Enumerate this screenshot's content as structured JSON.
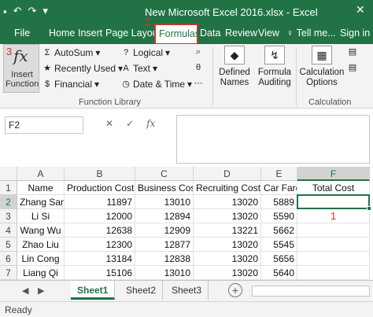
{
  "window": {
    "title": "New Microsoft Excel 2016.xlsx - Excel",
    "save_icon": "save-icon",
    "undo_icon": "undo-icon",
    "redo_icon": "redo-icon"
  },
  "tabs": [
    {
      "label": "File"
    },
    {
      "label": "Home"
    },
    {
      "label": "Insert"
    },
    {
      "label": "Page Layout"
    },
    {
      "label": "Formulas",
      "active": true
    },
    {
      "label": "Data"
    },
    {
      "label": "Review"
    },
    {
      "label": "View"
    }
  ],
  "tell_me": "Tell me...",
  "sign_in": "Sign in",
  "markers": {
    "m1": "1",
    "m2": "2",
    "m3": "3"
  },
  "ribbon": {
    "insert_function": {
      "icon": "fx",
      "label": "Insert Function"
    },
    "library": [
      {
        "label": "AutoSum",
        "icon": "Σ"
      },
      {
        "label": "Recently Used",
        "icon": "★"
      },
      {
        "label": "Financial",
        "icon": "$"
      },
      {
        "label": "Logical",
        "icon": "?"
      },
      {
        "label": "Text",
        "icon": "A"
      },
      {
        "label": "Date & Time",
        "icon": "◷"
      }
    ],
    "defined_names": "Defined Names",
    "formula_auditing": "Formula Auditing",
    "calc_options": "Calculation Options",
    "group_function_library": "Function Library",
    "group_calculation": "Calculation"
  },
  "formula_bar": {
    "name_box": "F2",
    "cancel": "✕",
    "enter": "✓",
    "fx": "fx",
    "value": ""
  },
  "columns": [
    "A",
    "B",
    "C",
    "D",
    "E",
    "F"
  ],
  "rows": [
    [
      "Name",
      "Production Cost",
      "Business Cost",
      "Recruiting Cost",
      "Car Fare",
      "Total Cost"
    ],
    [
      "Zhang San",
      "11897",
      "13010",
      "13020",
      "5889",
      ""
    ],
    [
      "Li Si",
      "12000",
      "12894",
      "13020",
      "5590",
      ""
    ],
    [
      "Wang Wu",
      "12638",
      "12909",
      "13221",
      "5662",
      ""
    ],
    [
      "Zhao Liu",
      "12300",
      "12877",
      "13020",
      "5545",
      ""
    ],
    [
      "Lin Cong",
      "13184",
      "12838",
      "13020",
      "5656",
      ""
    ],
    [
      "Liang Qi",
      "15106",
      "13010",
      "13020",
      "5640",
      ""
    ]
  ],
  "row_numbers": [
    "1",
    "2",
    "3",
    "4",
    "5",
    "6",
    "7"
  ],
  "sheets": [
    {
      "label": "Sheet1",
      "active": true
    },
    {
      "label": "Sheet2"
    },
    {
      "label": "Sheet3"
    }
  ],
  "status": "Ready",
  "colors": {
    "accent": "#217346",
    "marker": "#c0392b"
  }
}
